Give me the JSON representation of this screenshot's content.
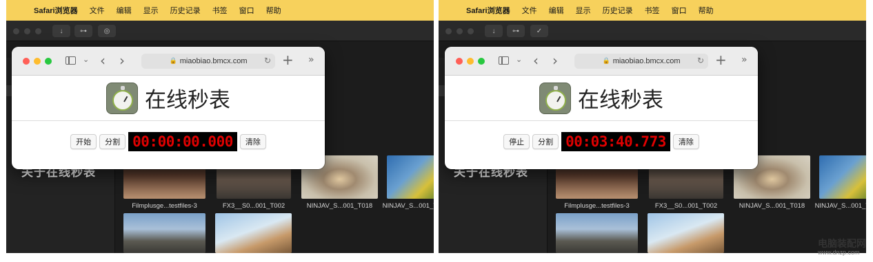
{
  "menubar": {
    "apple": "",
    "app": "Safari浏览器",
    "items": [
      "文件",
      "编辑",
      "显示",
      "历史记录",
      "书签",
      "窗口",
      "帮助"
    ]
  },
  "safari": {
    "url": "miaobiao.bmcx.com",
    "lock": "🔒",
    "sidebar_chevron": "⌄",
    "back": "‹",
    "forward": "›",
    "reload": "↻",
    "new_tab": "+",
    "overflow": "»"
  },
  "page": {
    "site_title": "在线秒表",
    "split_label": "分割",
    "clear_label": "清除"
  },
  "panels": {
    "left": {
      "start_stop_label": "开始",
      "timer": "00:00:00.000"
    },
    "right": {
      "start_stop_label": "停止",
      "timer": "00:03:40.773"
    }
  },
  "fcp": {
    "toolbar_icons": [
      "download-icon",
      "key-icon",
      "check-icon"
    ],
    "sidebar_partial_text": "关于在线秒表",
    "clips": [
      {
        "caption": "Filmplusge...testfiles-3",
        "color_a": "#5a3b2c",
        "color_b": "#b89070"
      },
      {
        "caption": "FX3__S0...001_T002",
        "color_a": "#2c2a28",
        "color_b": "#6a5a4e"
      },
      {
        "caption": "NINJAV_S...001_T018",
        "color_a": "#c9c0ac",
        "color_b": "#a08a70"
      },
      {
        "caption": "NINJAV_S...001_T0",
        "color_a": "#2f6db0",
        "color_b": "#d7c03a"
      },
      {
        "caption": "",
        "color_a": "#7aa0c8",
        "color_b": "#5b5a52"
      },
      {
        "caption": "",
        "color_a": "#9fc4e6",
        "color_b": "#c79a6a"
      }
    ]
  },
  "watermark": {
    "text": "电脑装配网",
    "url": "www.dnzp.com"
  },
  "colors": {
    "menubar": "#f7d15c",
    "timer_text": "#e00000",
    "timer_bg": "#000000"
  }
}
